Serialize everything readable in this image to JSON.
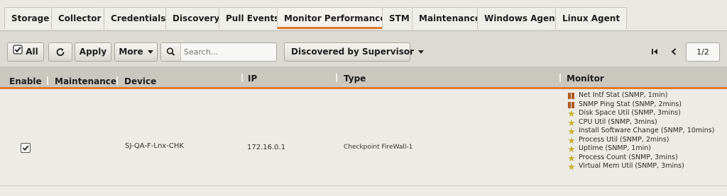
{
  "tabs": [
    {
      "label": "Storage",
      "active": false
    },
    {
      "label": "Collector",
      "active": false
    },
    {
      "label": "Credentials",
      "active": false
    },
    {
      "label": "Discovery",
      "active": false
    },
    {
      "label": "Pull Events",
      "active": false
    },
    {
      "label": "Monitor Performance",
      "active": true
    },
    {
      "label": "STM",
      "active": false
    },
    {
      "label": "Maintenance",
      "active": false
    },
    {
      "label": "Windows Agent",
      "active": false
    },
    {
      "label": "Linux Agent",
      "active": false
    }
  ],
  "toolbar": {
    "all_label": "All",
    "apply_label": "Apply",
    "more_label": "More",
    "search_placeholder": "Search...",
    "filter_label": "Discovered by Supervisor",
    "page_indicator": "1/2"
  },
  "columns": {
    "enable": "Enable",
    "maintenance": "Maintenance",
    "device": "Device",
    "ip": "IP",
    "type": "Type",
    "monitor": "Monitor"
  },
  "row": {
    "enabled": true,
    "device": "SJ-QA-F-Lnx-CHK",
    "ip": "172.16.0.1",
    "type": "Checkpoint FireWall-1",
    "monitors": [
      {
        "label": "Net Intf Stat (SNMP, 1min)",
        "icon": "bar-chart-icon"
      },
      {
        "label": "SNMP Ping Stat (SNMP, 2mins)",
        "icon": "bar-chart-icon"
      },
      {
        "label": "Disk Space Util (SNMP, 3mins)",
        "icon": "star-icon"
      },
      {
        "label": "CPU Util (SNMP, 3mins)",
        "icon": "star-icon"
      },
      {
        "label": "Install Software Change (SNMP, 10mins)",
        "icon": "star-icon"
      },
      {
        "label": "Process Util (SNMP, 2mins)",
        "icon": "star-icon"
      },
      {
        "label": "Uptime (SNMP, 1min)",
        "icon": "star-icon"
      },
      {
        "label": "Process Count (SNMP, 3mins)",
        "icon": "star-icon"
      },
      {
        "label": "Virtual Mem Util (SNMP, 3mins)",
        "icon": "star-icon"
      }
    ]
  },
  "colors": {
    "accent": "#e07a2e",
    "bar_icon": "#b0581e",
    "star_icon": "#c9b230"
  }
}
